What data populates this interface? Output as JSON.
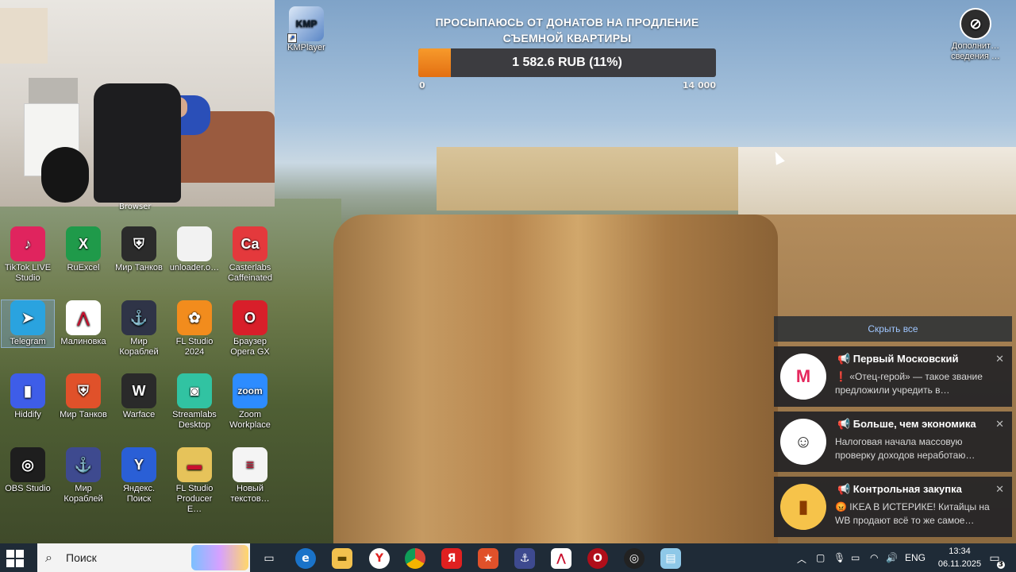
{
  "donation": {
    "title_line1": "ПРОСЫПАЮСЬ ОТ ДОНАТОВ НА ПРОДЛЕНИЕ",
    "title_line2": "СЪЕМНОЙ КВАРТИРЫ",
    "amount_text": "1 582.6 RUB (11%)",
    "progress_fraction": 0.11,
    "min": "0",
    "max": "14 000",
    "colors": {
      "fill": "#f08a20",
      "track": "#3c3c40"
    }
  },
  "webcam": {
    "caption": "Browser"
  },
  "top_icons": [
    {
      "label": "KMPlayer",
      "icon": "kmplayer-icon"
    },
    {
      "label": "Дополнит… сведения …",
      "icon": "info-icon"
    }
  ],
  "desktop_icons": [
    {
      "label": "TikTok LIVE Studio",
      "icon": "tiktok-icon",
      "color": "#e0245e"
    },
    {
      "label": "RuExcel",
      "icon": "excel-icon",
      "color": "#1f9a4a"
    },
    {
      "label": "Мир Танков",
      "icon": "tank-icon",
      "color": "#2b2b2b"
    },
    {
      "label": "unloader.o…",
      "icon": "file-icon",
      "color": "#f2f2f2"
    },
    {
      "label": "Casterlabs Caffeinated",
      "icon": "casterlabs-icon",
      "color": "#e4393c"
    },
    {
      "label": "Telegram",
      "icon": "telegram-icon",
      "color": "#2aa3df"
    },
    {
      "label": "Малиновка",
      "icon": "malinovka-icon",
      "color": "#ffffff"
    },
    {
      "label": "Мир Кораблей",
      "icon": "ship-icon",
      "color": "#2f3447"
    },
    {
      "label": "FL Studio 2024",
      "icon": "flstudio-icon",
      "color": "#f28c1d"
    },
    {
      "label": "Браузер Opera GX",
      "icon": "operagx-icon",
      "color": "#d81f2a"
    },
    {
      "label": "Hiddify",
      "icon": "hiddify-icon",
      "color": "#3e5de8"
    },
    {
      "label": "Мир Танков",
      "icon": "tank-icon",
      "color": "#e0512a"
    },
    {
      "label": "Warface",
      "icon": "warface-icon",
      "color": "#2a2a2a"
    },
    {
      "label": "Streamlabs Desktop",
      "icon": "streamlabs-icon",
      "color": "#31c3a2"
    },
    {
      "label": "Zoom Workplace",
      "icon": "zoom-icon",
      "color": "#2d8cff"
    },
    {
      "label": "OBS Studio",
      "icon": "obs-icon",
      "color": "#1e1e1e"
    },
    {
      "label": "Мир Кораблей",
      "icon": "ship-icon",
      "color": "#3e4a8f"
    },
    {
      "label": "Яндекс. Поиск",
      "icon": "yandex-icon",
      "color": "#2a5fd6"
    },
    {
      "label": "FL Studio Producer E…",
      "icon": "folder-icon",
      "color": "#e6c35a"
    },
    {
      "label": "Новый текстов…",
      "icon": "textfile-icon",
      "color": "#f4f4f4"
    }
  ],
  "notifications": {
    "hide_all": "Скрыть все",
    "items": [
      {
        "channel": "📢 Первый Московский",
        "text": "❗ «Отец-герой» — такое звание предложили учредить в…",
        "avatar": "М",
        "avatar_color": "#e5285d"
      },
      {
        "channel": "📢 Больше, чем экономика",
        "text": "Налоговая начала массовую проверку доходов неработаю…",
        "avatar": "☺",
        "avatar_color": "#222222"
      },
      {
        "channel": "📢 Контрольная закупка",
        "text": "😡 IKEA В ИСТЕРИКЕ! Китайцы на WB продают всё то же самое…",
        "avatar": "▮",
        "avatar_color": "#f0a020"
      }
    ]
  },
  "taskbar": {
    "search_placeholder": "Поиск",
    "lang": "ENG",
    "time": "13:34",
    "date": "06.11.2025",
    "notif_count": "3"
  }
}
